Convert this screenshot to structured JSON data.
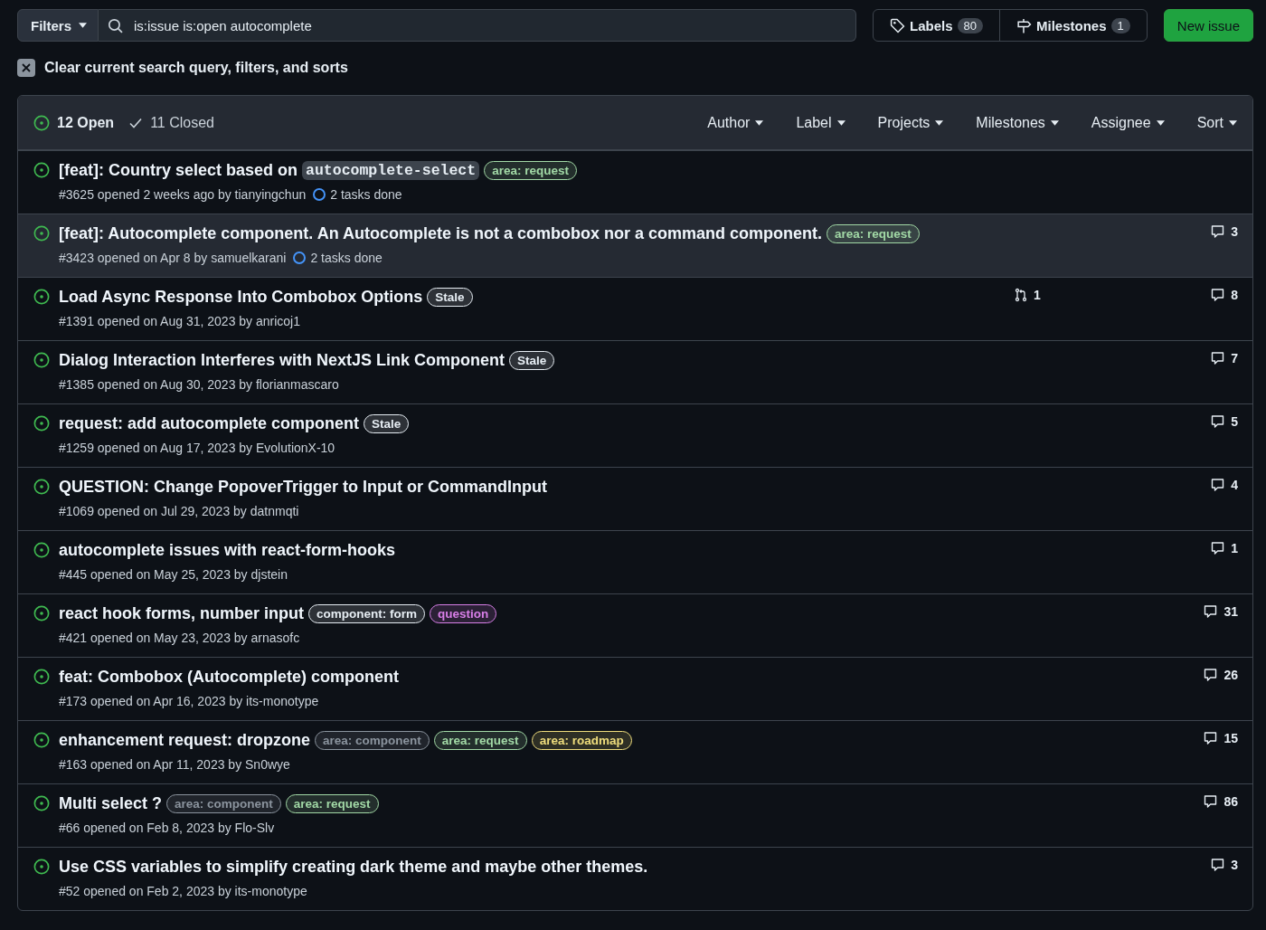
{
  "toolbar": {
    "filters_button": "Filters",
    "search": {
      "value": "is:issue is:open autocomplete"
    },
    "labels": {
      "label": "Labels",
      "count": "80"
    },
    "milestones": {
      "label": "Milestones",
      "count": "1"
    },
    "new_issue": "New issue"
  },
  "clear_filters": "Clear current search query, filters, and sorts",
  "list_header": {
    "states": [
      {
        "label": "12 Open",
        "selected": true,
        "kind": "open"
      },
      {
        "label": "11 Closed",
        "selected": false,
        "kind": "closed"
      }
    ],
    "filters": [
      "Author",
      "Label",
      "Projects",
      "Milestones",
      "Assignee",
      "Sort"
    ]
  },
  "issues": [
    {
      "title": "[feat]: Country select based on",
      "code": "autocomplete-select",
      "labels": [
        {
          "text": "area: request",
          "color": "#a2d9a6"
        }
      ],
      "meta": "#3625 opened 2 weeks ago by tianyingchun",
      "tasks": "2 tasks done",
      "selected": false
    },
    {
      "title": "[feat]: Autocomplete component. An Autocomplete is not a combobox nor a command component.",
      "labels": [
        {
          "text": "area: request",
          "color": "#a2d9a6"
        }
      ],
      "meta": "#3423 opened on Apr 8 by samuelkarani",
      "tasks": "2 tasks done",
      "comments": "3",
      "selected": true
    },
    {
      "title": "Load Async Response Into Combobox Options",
      "labels": [
        {
          "text": "Stale",
          "color": "#e6edf3"
        }
      ],
      "meta": "#1391 opened on Aug 31, 2023 by anricoj1",
      "pulls": "1",
      "comments": "8",
      "selected": false
    },
    {
      "title": "Dialog Interaction Interferes with NextJS Link Component",
      "labels": [
        {
          "text": "Stale",
          "color": "#e6edf3"
        }
      ],
      "meta": "#1385 opened on Aug 30, 2023 by florianmascaro",
      "comments": "7",
      "selected": false
    },
    {
      "title": "request: add autocomplete component",
      "labels": [
        {
          "text": "Stale",
          "color": "#e6edf3"
        }
      ],
      "meta": "#1259 opened on Aug 17, 2023 by EvolutionX-10",
      "comments": "5",
      "selected": false
    },
    {
      "title": "QUESTION: Change PopoverTrigger to Input or CommandInput",
      "meta": "#1069 opened on Jul 29, 2023 by datnmqti",
      "comments": "4",
      "selected": false
    },
    {
      "title": "autocomplete issues with react-form-hooks",
      "meta": "#445 opened on May 25, 2023 by djstein",
      "comments": "1",
      "selected": false
    },
    {
      "title": "react hook forms, number input",
      "labels": [
        {
          "text": "component: form",
          "color": "#e6edf3"
        },
        {
          "text": "question",
          "color": "#d87fe8"
        }
      ],
      "meta": "#421 opened on May 23, 2023 by arnasofc",
      "comments": "31",
      "selected": false
    },
    {
      "title": "feat: Combobox (Autocomplete) component",
      "meta": "#173 opened on Apr 16, 2023 by its-monotype",
      "comments": "26",
      "selected": false
    },
    {
      "title": "enhancement request: dropzone",
      "labels": [
        {
          "text": "area: component",
          "color": "#8b949e"
        },
        {
          "text": "area: request",
          "color": "#a2d9a6"
        },
        {
          "text": "area: roadmap",
          "color": "#eedc7c"
        }
      ],
      "meta": "#163 opened on Apr 11, 2023 by Sn0wye",
      "comments": "15",
      "selected": false
    },
    {
      "title": "Multi select ?",
      "labels": [
        {
          "text": "area: component",
          "color": "#8b949e"
        },
        {
          "text": "area: request",
          "color": "#a2d9a6"
        }
      ],
      "meta": "#66 opened on Feb 8, 2023 by Flo-Slv",
      "comments": "86",
      "selected": false
    },
    {
      "title": "Use CSS variables to simplify creating dark theme and maybe other themes.",
      "meta": "#52 opened on Feb 2, 2023 by its-monotype",
      "comments": "3",
      "selected": false
    }
  ]
}
